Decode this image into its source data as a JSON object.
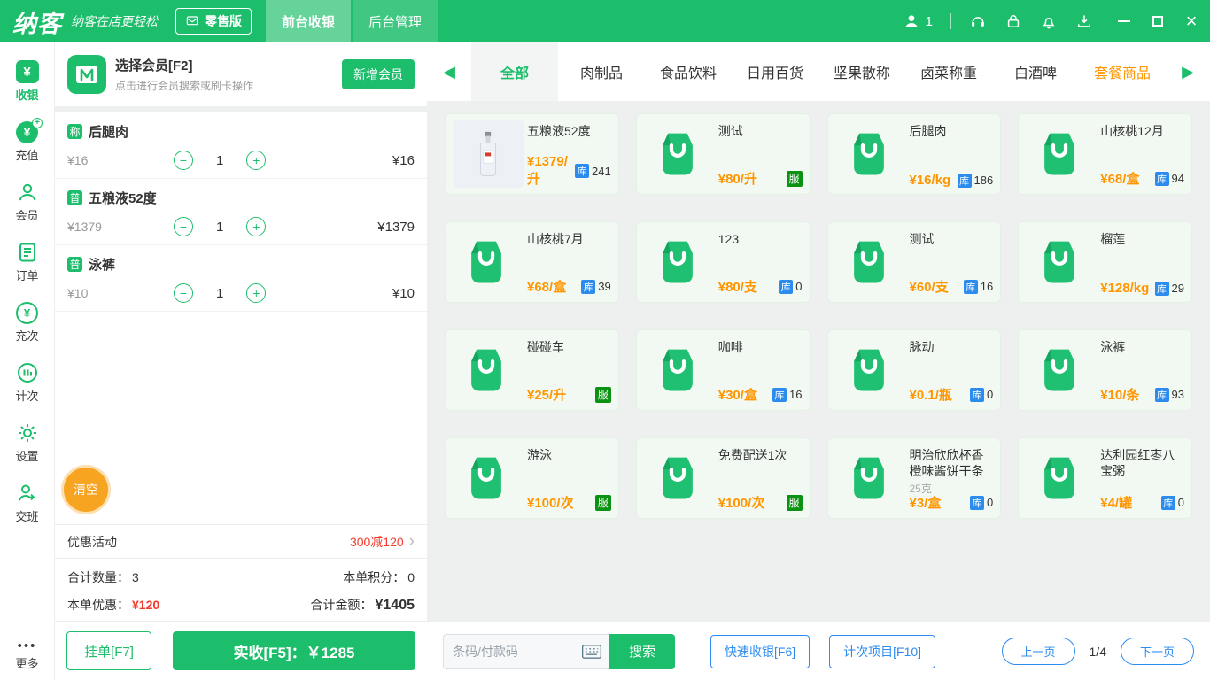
{
  "topbar": {
    "logo": "纳客",
    "slogan": "纳客在店更轻松",
    "edition": "零售版",
    "user_count": "1",
    "tabs": [
      {
        "key": "front-cashier",
        "label": "前台收银",
        "active": true
      },
      {
        "key": "back-manage",
        "label": "后台管理",
        "active": false
      }
    ]
  },
  "sidebar": {
    "items": [
      {
        "key": "cashier",
        "label": "收银",
        "active": true
      },
      {
        "key": "recharge",
        "label": "充值",
        "active": false
      },
      {
        "key": "member",
        "label": "会员",
        "active": false
      },
      {
        "key": "orders",
        "label": "订单",
        "active": false
      },
      {
        "key": "recharge-times",
        "label": "充次",
        "active": false
      },
      {
        "key": "count-times",
        "label": "计次",
        "active": false
      },
      {
        "key": "settings",
        "label": "设置",
        "active": false
      },
      {
        "key": "shift",
        "label": "交班",
        "active": false
      }
    ],
    "more_label": "更多"
  },
  "member_panel": {
    "title": "选择会员[F2]",
    "subtitle": "点击进行会员搜索或刷卡操作",
    "add_button": "新增会员"
  },
  "cart": {
    "items": [
      {
        "badge": "称",
        "name": "后腿肉",
        "price": "¥16",
        "qty": "1",
        "total": "¥16"
      },
      {
        "badge": "普",
        "name": "五粮液52度",
        "price": "¥1379",
        "qty": "1",
        "total": "¥1379"
      },
      {
        "badge": "普",
        "name": "泳裤",
        "price": "¥10",
        "qty": "1",
        "total": "¥10"
      }
    ],
    "clear_button": "清空",
    "promo_label": "优惠活动",
    "promo_value": "300减120",
    "total_qty_label": "合计数量：",
    "total_qty": "3",
    "points_label": "本单积分：",
    "points": "0",
    "discount_label": "本单优惠：",
    "discount": "¥120",
    "amount_label": "合计金额：",
    "amount": "¥1405",
    "hold_button": "挂单[F7]",
    "pay_button": "实收[F5]：￥1285"
  },
  "categories": [
    {
      "label": "全部",
      "state": "active"
    },
    {
      "label": "肉制品",
      "state": ""
    },
    {
      "label": "食品饮料",
      "state": ""
    },
    {
      "label": "日用百货",
      "state": ""
    },
    {
      "label": "坚果散称",
      "state": ""
    },
    {
      "label": "卤菜称重",
      "state": ""
    },
    {
      "label": "白酒啤",
      "state": ""
    },
    {
      "label": "套餐商品",
      "state": "highlight"
    }
  ],
  "labels": {
    "stock_badge": "库",
    "service_badge": "服"
  },
  "products": [
    {
      "name": "五粮液52度",
      "price": "¥1379/升",
      "stock": "241",
      "type": "stock",
      "image": "bottle"
    },
    {
      "name": "测试",
      "price": "¥80/升",
      "type": "service"
    },
    {
      "name": "后腿肉",
      "price": "¥16/kg",
      "stock": "186",
      "type": "stock"
    },
    {
      "name": "山核桃12月",
      "price": "¥68/盒",
      "stock": "94",
      "type": "stock"
    },
    {
      "name": "山核桃7月",
      "price": "¥68/盒",
      "stock": "39",
      "type": "stock"
    },
    {
      "name": "123",
      "price": "¥80/支",
      "stock": "0",
      "type": "stock"
    },
    {
      "name": "测试",
      "price": "¥60/支",
      "stock": "16",
      "type": "stock"
    },
    {
      "name": "榴莲",
      "price": "¥128/kg",
      "stock": "29",
      "type": "stock"
    },
    {
      "name": "碰碰车",
      "price": "¥25/升",
      "type": "service"
    },
    {
      "name": "咖啡",
      "price": "¥30/盒",
      "stock": "16",
      "type": "stock"
    },
    {
      "name": "脉动",
      "price": "¥0.1/瓶",
      "stock": "0",
      "type": "stock"
    },
    {
      "name": "泳裤",
      "price": "¥10/条",
      "stock": "93",
      "type": "stock"
    },
    {
      "name": "游泳",
      "price": "¥100/次",
      "type": "service"
    },
    {
      "name": "免费配送1次",
      "price": "¥100/次",
      "type": "service"
    },
    {
      "name": "明治欣欣杯香橙味酱饼干条",
      "sub": "25克",
      "price": "¥3/盒",
      "stock": "0",
      "type": "stock"
    },
    {
      "name": "达利园红枣八宝粥",
      "price": "¥4/罐",
      "stock": "0",
      "type": "stock"
    }
  ],
  "bottom_bar": {
    "search_placeholder": "条码/付款码",
    "search_button": "搜索",
    "quick_cashier_button": "快速收银[F6]",
    "count_item_button": "计次项目[F10]",
    "prev_button": "上一页",
    "page_indicator": "1/4",
    "next_button": "下一页"
  }
}
